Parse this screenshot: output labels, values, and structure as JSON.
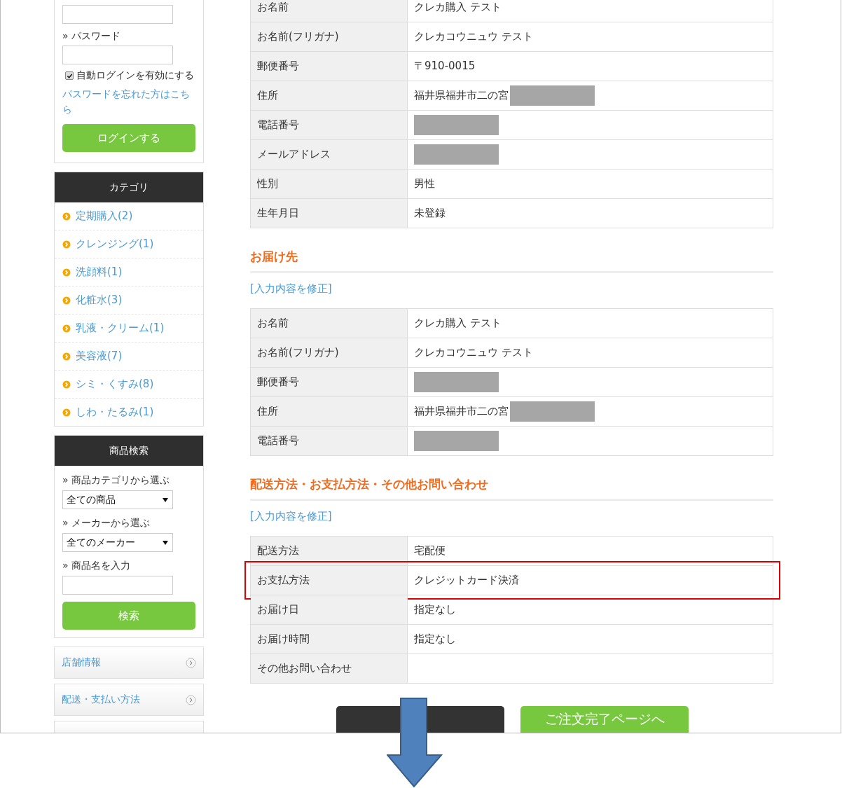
{
  "sidebar": {
    "login": {
      "password_label": "» パスワード",
      "auto_login": {
        "label": "自動ログインを有効にする",
        "checked": true
      },
      "forgot_link": "パスワードを忘れた方はこちら",
      "login_button": "ログインする"
    },
    "categories": {
      "title": "カテゴリ",
      "items": [
        "定期購入(2)",
        "クレンジング(1)",
        "洗顔料(1)",
        "化粧水(3)",
        "乳液・クリーム(1)",
        "美容液(7)",
        "シミ・くすみ(8)",
        "しわ・たるみ(1)"
      ]
    },
    "product_search": {
      "title": "商品検索",
      "fields": [
        {
          "kind": "select",
          "label": "» 商品カテゴリから選ぶ",
          "value": "全ての商品"
        },
        {
          "kind": "select",
          "label": "» メーカーから選ぶ",
          "value": "全てのメーカー"
        },
        {
          "kind": "text",
          "label": "» 商品名を入力"
        }
      ],
      "search_button": "検索"
    },
    "links": [
      "店舗情報",
      "配送・支払い方法"
    ]
  },
  "customer_table": [
    {
      "label": "お名前",
      "value": "クレカ購入 テスト"
    },
    {
      "label": "お名前(フリガナ)",
      "value": "クレカコウニュウ テスト"
    },
    {
      "label": "郵便番号",
      "value": "〒910-0015"
    },
    {
      "label": "住所",
      "value": "福井県福井市二の宮",
      "redacted": true
    },
    {
      "label": "電話番号",
      "redacted": true
    },
    {
      "label": "メールアドレス",
      "redacted": true
    },
    {
      "label": "性別",
      "value": "男性"
    },
    {
      "label": "生年月日",
      "value": "未登録"
    }
  ],
  "sections": [
    {
      "heading": "お届け先",
      "edit_link": "[入力内容を修正]",
      "rows": [
        {
          "label": "お名前",
          "value": "クレカ購入 テスト"
        },
        {
          "label": "お名前(フリガナ)",
          "value": "クレカコウニュウ テスト"
        },
        {
          "label": "郵便番号",
          "redacted": true
        },
        {
          "label": "住所",
          "value": "福井県福井市二の宮",
          "redacted": true
        },
        {
          "label": "電話番号",
          "redacted": true
        }
      ]
    },
    {
      "heading": "配送方法・お支払方法・その他お問い合わせ",
      "edit_link": "[入力内容を修正]",
      "rows": [
        {
          "label": "配送方法",
          "value": "宅配便"
        },
        {
          "label": "お支払方法",
          "value": "クレジットカード決済",
          "highlighted": true
        },
        {
          "label": "お届け日",
          "value": "指定なし"
        },
        {
          "label": "お届け時間",
          "value": "指定なし"
        },
        {
          "label": "その他お問い合わせ"
        }
      ]
    }
  ],
  "buttons": [
    {
      "kind": "back"
    },
    {
      "kind": "next",
      "label": "ご注文完了ページへ"
    }
  ]
}
